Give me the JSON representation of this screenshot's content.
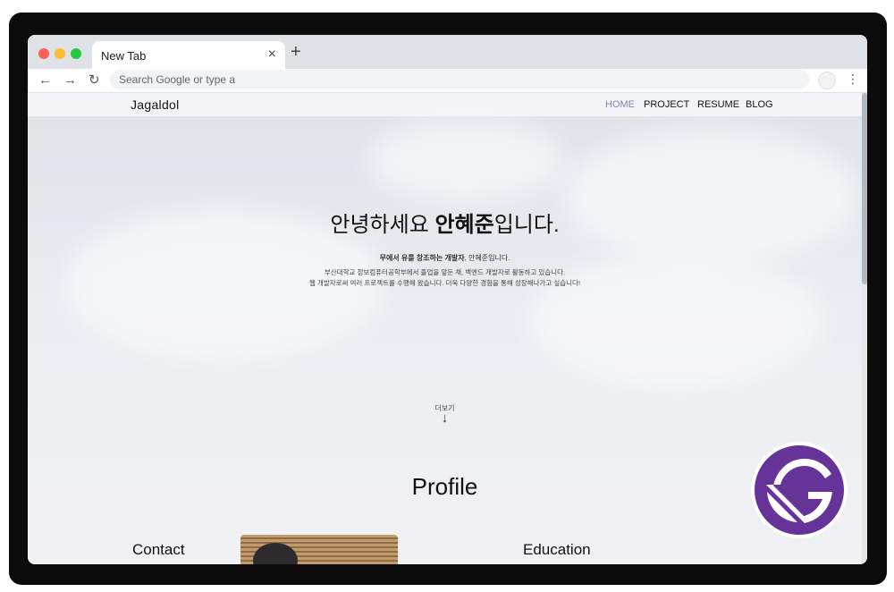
{
  "browser": {
    "tab_title": "New Tab",
    "tab_close": "×",
    "new_tab": "+",
    "back": "←",
    "forward": "→",
    "reload": "↻",
    "address_placeholder": "Search Google or type a",
    "menu": "⋮"
  },
  "site": {
    "logo": "Jagaldol",
    "nav": [
      {
        "label": "HOME",
        "active": true
      },
      {
        "label": "PROJECT",
        "active": false
      },
      {
        "label": "RESUME",
        "active": false
      },
      {
        "label": "BLOG",
        "active": false
      }
    ],
    "hero": {
      "title_prefix": "안녕하세요 ",
      "title_name": "안혜준",
      "title_suffix": "입니다.",
      "tagline_bold": "무에서 유를 창조하는 개발자",
      "tagline_rest": ", 안혜준입니다.",
      "line1": "부산대학교 정보컴퓨터공학부에서 졸업을 앞둔 채, 백엔드 개발자로 활동하고 있습니다.",
      "line2": "웹 개발자로써 여러 프로젝트를 수행해 왔습니다. 더욱 다양한 경험을 통해 성장해나가고 싶습니다!"
    },
    "more_label": "더보기",
    "more_arrow": "↓",
    "profile_heading": "Profile",
    "contact_heading": "Contact",
    "education_heading": "Education"
  },
  "colors": {
    "gatsby_purple": "#663399",
    "active_nav": "#7a8aa6"
  }
}
